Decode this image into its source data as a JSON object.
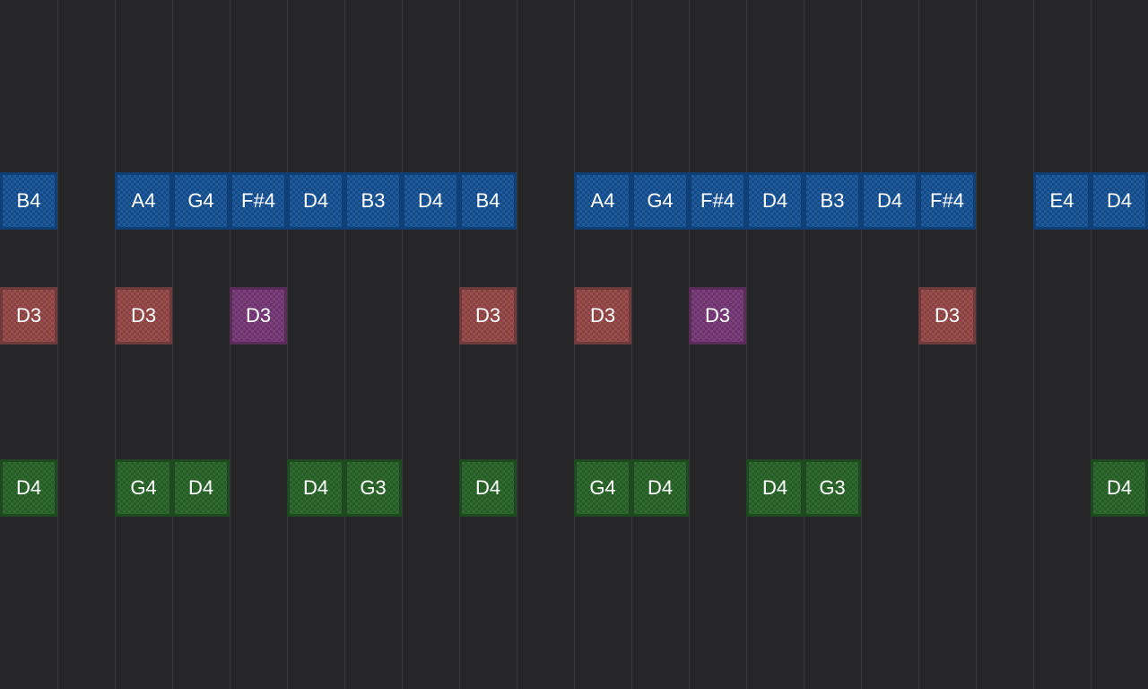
{
  "colors": {
    "background": "#262628",
    "grid_line": "#3a3a3d",
    "blue": {
      "fill": "#1d5a9e",
      "dark": "#164a85",
      "border": "#0f3f73"
    },
    "red": {
      "fill": "#9a4e4e",
      "dark": "#874242",
      "border": "#6f3a3a"
    },
    "purple": {
      "fill": "#7e3f7e",
      "dark": "#6b346b",
      "border": "#5a2c5a"
    },
    "green": {
      "fill": "#2f6b2f",
      "dark": "#275c27",
      "border": "#1f4a1f"
    }
  },
  "tracks": [
    {
      "name": "blue",
      "notes": [
        {
          "step": 0,
          "pitch": "B4",
          "color": "blue"
        },
        {
          "step": 2,
          "pitch": "A4",
          "color": "blue"
        },
        {
          "step": 3,
          "pitch": "G4",
          "color": "blue"
        },
        {
          "step": 4,
          "pitch": "F#4",
          "color": "blue"
        },
        {
          "step": 5,
          "pitch": "D4",
          "color": "blue"
        },
        {
          "step": 6,
          "pitch": "B3",
          "color": "blue"
        },
        {
          "step": 7,
          "pitch": "D4",
          "color": "blue"
        },
        {
          "step": 8,
          "pitch": "B4",
          "color": "blue"
        },
        {
          "step": 10,
          "pitch": "A4",
          "color": "blue"
        },
        {
          "step": 11,
          "pitch": "G4",
          "color": "blue"
        },
        {
          "step": 12,
          "pitch": "F#4",
          "color": "blue"
        },
        {
          "step": 13,
          "pitch": "D4",
          "color": "blue"
        },
        {
          "step": 14,
          "pitch": "B3",
          "color": "blue"
        },
        {
          "step": 15,
          "pitch": "D4",
          "color": "blue"
        },
        {
          "step": 16,
          "pitch": "F#4",
          "color": "blue"
        },
        {
          "step": 18,
          "pitch": "E4",
          "color": "blue"
        },
        {
          "step": 19,
          "pitch": "D4",
          "color": "blue"
        }
      ]
    },
    {
      "name": "red",
      "notes": [
        {
          "step": 0,
          "pitch": "D3",
          "color": "red"
        },
        {
          "step": 2,
          "pitch": "D3",
          "color": "red"
        },
        {
          "step": 4,
          "pitch": "D3",
          "color": "purple"
        },
        {
          "step": 8,
          "pitch": "D3",
          "color": "red"
        },
        {
          "step": 10,
          "pitch": "D3",
          "color": "red"
        },
        {
          "step": 12,
          "pitch": "D3",
          "color": "purple"
        },
        {
          "step": 16,
          "pitch": "D3",
          "color": "red"
        }
      ]
    },
    {
      "name": "green",
      "notes": [
        {
          "step": 0,
          "pitch": "D4",
          "color": "green"
        },
        {
          "step": 2,
          "pitch": "G4",
          "color": "green"
        },
        {
          "step": 3,
          "pitch": "D4",
          "color": "green"
        },
        {
          "step": 5,
          "pitch": "D4",
          "color": "green"
        },
        {
          "step": 6,
          "pitch": "G3",
          "color": "green"
        },
        {
          "step": 8,
          "pitch": "D4",
          "color": "green"
        },
        {
          "step": 10,
          "pitch": "G4",
          "color": "green"
        },
        {
          "step": 11,
          "pitch": "D4",
          "color": "green"
        },
        {
          "step": 13,
          "pitch": "D4",
          "color": "green"
        },
        {
          "step": 14,
          "pitch": "G3",
          "color": "green"
        },
        {
          "step": 19,
          "pitch": "D4",
          "color": "green"
        }
      ]
    }
  ]
}
